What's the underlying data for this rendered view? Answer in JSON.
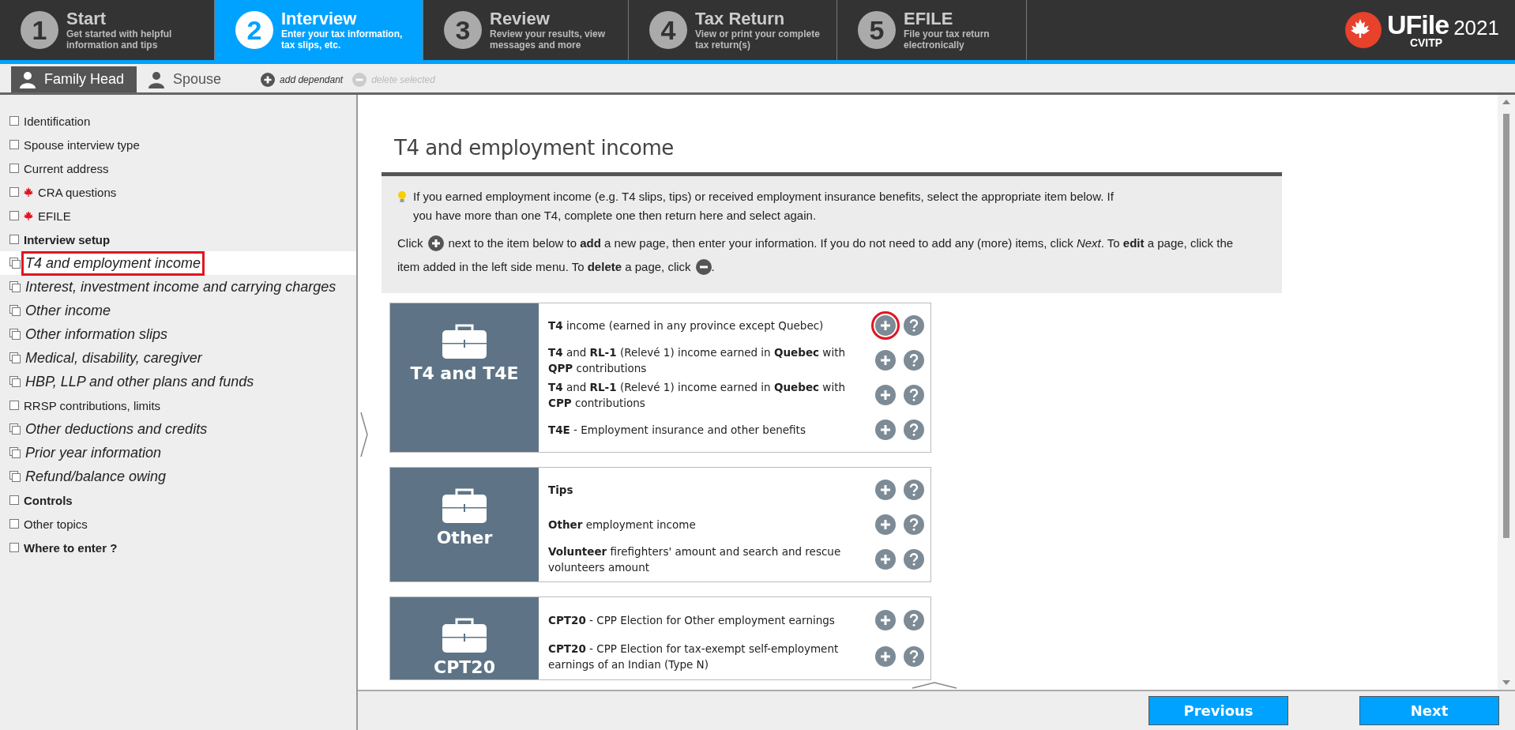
{
  "steps": [
    {
      "number": "1",
      "title": "Start",
      "desc_lines": [
        "Get started with helpful",
        "information and tips"
      ],
      "selected": false
    },
    {
      "number": "2",
      "title": "Interview",
      "desc_lines": [
        "Enter your tax information,",
        "tax slips, etc."
      ],
      "selected": true
    },
    {
      "number": "3",
      "title": "Review",
      "desc_lines": [
        "Review your results, view",
        "messages and more"
      ],
      "selected": false
    },
    {
      "number": "4",
      "title": "Tax Return",
      "desc_lines": [
        "View or print your complete",
        "tax return(s)"
      ],
      "selected": false
    },
    {
      "number": "5",
      "title": "EFILE",
      "desc_lines": [
        "File your tax return",
        "electronically"
      ],
      "selected": false
    }
  ],
  "logo": {
    "name": "UFile",
    "edition": "CVITP",
    "year": "2021"
  },
  "person_tabs": [
    {
      "label": "Family Head",
      "selected": true
    },
    {
      "label": "Spouse",
      "selected": false
    }
  ],
  "person_actions": [
    {
      "kind": "add",
      "label": "add dependant",
      "disabled": false
    },
    {
      "kind": "delete",
      "label": "delete selected",
      "disabled": true
    }
  ],
  "sidebar": {
    "items": [
      {
        "label": "Identification",
        "kind": "check",
        "flag": false,
        "selected": false
      },
      {
        "label": "Spouse interview type",
        "kind": "check",
        "flag": false,
        "selected": false
      },
      {
        "label": "Current address",
        "kind": "check",
        "flag": false,
        "selected": false
      },
      {
        "label": "CRA questions",
        "kind": "check",
        "flag": true,
        "selected": false
      },
      {
        "label": "EFILE",
        "kind": "check",
        "flag": true,
        "selected": false
      },
      {
        "label": "Interview setup",
        "kind": "section",
        "flag": false,
        "selected": false
      },
      {
        "label": "T4 and employment income",
        "kind": "pages",
        "flag": false,
        "selected": true
      },
      {
        "label": "Interest, investment income and carrying charges",
        "kind": "pages",
        "flag": false,
        "selected": false
      },
      {
        "label": "Other income",
        "kind": "pages",
        "flag": false,
        "selected": false
      },
      {
        "label": "Other information slips",
        "kind": "pages",
        "flag": false,
        "selected": false
      },
      {
        "label": "Medical, disability, caregiver",
        "kind": "pages",
        "flag": false,
        "selected": false
      },
      {
        "label": "HBP, LLP and other plans and funds",
        "kind": "pages",
        "flag": false,
        "selected": false
      },
      {
        "label": "RRSP contributions, limits",
        "kind": "check",
        "flag": false,
        "selected": false
      },
      {
        "label": "Other deductions and credits",
        "kind": "pages",
        "flag": false,
        "selected": false
      },
      {
        "label": "Prior year information",
        "kind": "pages",
        "flag": false,
        "selected": false
      },
      {
        "label": "Refund/balance owing",
        "kind": "pages",
        "flag": false,
        "selected": false
      },
      {
        "label": "Controls",
        "kind": "section",
        "flag": false,
        "selected": false
      },
      {
        "label": "Other topics",
        "kind": "check",
        "flag": false,
        "selected": false
      },
      {
        "label": "Where to enter ?",
        "kind": "section",
        "flag": false,
        "selected": false
      }
    ]
  },
  "page": {
    "title": "T4 and employment income",
    "info": "If you earned employment income (e.g. T4 slips, tips) or received employment insurance benefits, select the appropriate item below. If you have more than one T4, complete one then return here and select again.",
    "instructions": {
      "lead": "Click",
      "middle": "next to the item below to **add** a new page, then enter your information. If you do not need to add any (more) items, click *Next*. To **edit** a page, click the",
      "second_line": "item added in the left side menu. To **delete** a page, click",
      "end": "."
    },
    "groups": [
      {
        "title": "T4 and T4E",
        "items": [
          {
            "text": "**T4** income (earned in any province except Quebec)",
            "outlined": true
          },
          {
            "text": "**T4** and **RL-1** (Relevé 1) income earned in **Quebec** with **QPP** contributions",
            "outlined": false
          },
          {
            "text": "**T4** and **RL-1** (Relevé 1) income earned in **Quebec** with **CPP** contributions",
            "outlined": false
          },
          {
            "text": "**T4E** - Employment insurance and other benefits",
            "outlined": false
          }
        ]
      },
      {
        "title": "Other",
        "items": [
          {
            "text": "**Tips**",
            "outlined": false
          },
          {
            "text": "**Other** employment income",
            "outlined": false
          },
          {
            "text": "**Volunteer** firefighters' amount and search and rescue volunteers amount",
            "outlined": false
          }
        ]
      },
      {
        "title": "CPT20",
        "items": [
          {
            "text": "**CPT20** - CPP Election for Other employment earnings",
            "outlined": false
          },
          {
            "text": "**CPT20** - CPP Election for tax-exempt self-employment earnings of an Indian (Type N)",
            "outlined": false
          }
        ]
      }
    ]
  },
  "footer": {
    "buttons": [
      "Previous",
      "Next"
    ]
  }
}
